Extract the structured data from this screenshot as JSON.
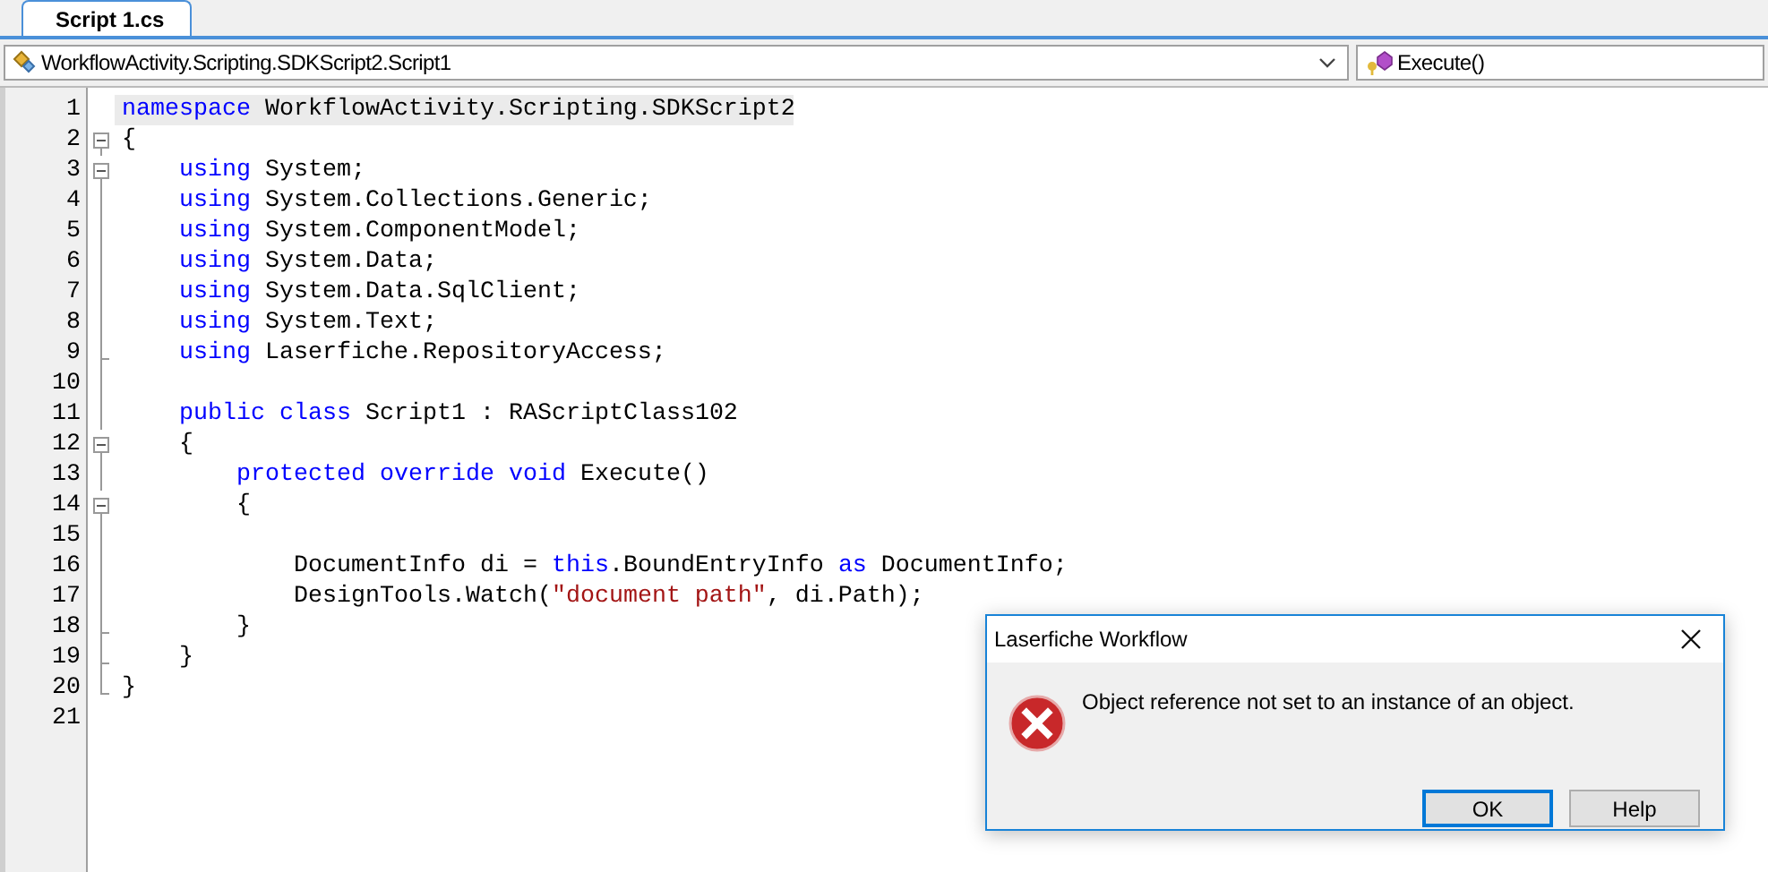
{
  "tabs": [
    {
      "label": "Script 1.cs",
      "selected": true
    }
  ],
  "nav": {
    "type_dropdown": "WorkflowActivity.Scripting.SDKScript2.Script1",
    "member_dropdown": "Execute()"
  },
  "lines": [
    {
      "number": "1",
      "kind": "plain",
      "current": true,
      "tokens": [
        {
          "kind": "keyword",
          "text": "namespace"
        },
        {
          "kind": "plain",
          "text": " WorkflowActivity.Scripting.SDKScript2"
        }
      ]
    },
    {
      "number": "2",
      "kind": "fold-start",
      "current": false,
      "tokens": [
        {
          "kind": "plain",
          "text": "{"
        }
      ]
    },
    {
      "number": "3",
      "kind": "fold-start",
      "current": false,
      "tokens": [
        {
          "kind": "keyword",
          "text": "    using"
        },
        {
          "kind": "plain",
          "text": " System;"
        }
      ]
    },
    {
      "number": "4",
      "kind": "fold-inner",
      "current": false,
      "tokens": [
        {
          "kind": "keyword",
          "text": "    using"
        },
        {
          "kind": "plain",
          "text": " System.Collections.Generic;"
        }
      ]
    },
    {
      "number": "5",
      "kind": "fold-inner",
      "current": false,
      "tokens": [
        {
          "kind": "keyword",
          "text": "    using"
        },
        {
          "kind": "plain",
          "text": " System.ComponentModel;"
        }
      ]
    },
    {
      "number": "6",
      "kind": "fold-inner",
      "current": false,
      "tokens": [
        {
          "kind": "keyword",
          "text": "    using"
        },
        {
          "kind": "plain",
          "text": " System.Data;"
        }
      ]
    },
    {
      "number": "7",
      "kind": "fold-inner",
      "current": false,
      "tokens": [
        {
          "kind": "keyword",
          "text": "    using"
        },
        {
          "kind": "plain",
          "text": " System.Data.SqlClient;"
        }
      ]
    },
    {
      "number": "8",
      "kind": "fold-inner",
      "current": false,
      "tokens": [
        {
          "kind": "keyword",
          "text": "    using"
        },
        {
          "kind": "plain",
          "text": " System.Text;"
        }
      ]
    },
    {
      "number": "9",
      "kind": "fold-end",
      "current": false,
      "tokens": [
        {
          "kind": "keyword",
          "text": "    using"
        },
        {
          "kind": "plain",
          "text": " Laserfiche.RepositoryAccess;"
        }
      ]
    },
    {
      "number": "10",
      "kind": "fold-inner",
      "current": false
    },
    {
      "number": "11",
      "kind": "fold-inner",
      "current": false,
      "tokens": [
        {
          "kind": "keyword",
          "text": "    public class"
        },
        {
          "kind": "plain",
          "text": " Script1 : RAScriptClass102"
        }
      ]
    },
    {
      "number": "12",
      "kind": "fold-start",
      "current": false,
      "tokens": [
        {
          "kind": "plain",
          "text": "    {"
        }
      ]
    },
    {
      "number": "13",
      "kind": "fold-inner",
      "current": false,
      "tokens": [
        {
          "kind": "keyword",
          "text": "        protected override void"
        },
        {
          "kind": "plain",
          "text": " Execute()"
        }
      ]
    },
    {
      "number": "14",
      "kind": "fold-start",
      "current": false,
      "tokens": [
        {
          "kind": "plain",
          "text": "        {"
        }
      ]
    },
    {
      "number": "15",
      "kind": "fold-inner",
      "current": false
    },
    {
      "number": "16",
      "kind": "fold-inner",
      "current": false,
      "tokens": [
        {
          "kind": "plain",
          "text": "            DocumentInfo di = "
        },
        {
          "kind": "keyword",
          "text": "this"
        },
        {
          "kind": "plain",
          "text": ".BoundEntryInfo "
        },
        {
          "kind": "keyword",
          "text": "as"
        },
        {
          "kind": "plain",
          "text": " DocumentInfo;"
        }
      ]
    },
    {
      "number": "17",
      "kind": "fold-inner",
      "current": false,
      "tokens": [
        {
          "kind": "plain",
          "text": "            DesignTools.Watch("
        },
        {
          "kind": "string",
          "text": "\"document path\""
        },
        {
          "kind": "plain",
          "text": ", di.Path);"
        }
      ]
    },
    {
      "number": "18",
      "kind": "fold-end",
      "current": false,
      "tokens": [
        {
          "kind": "plain",
          "text": "        }"
        }
      ]
    },
    {
      "number": "19",
      "kind": "fold-end",
      "current": false,
      "tokens": [
        {
          "kind": "plain",
          "text": "    }"
        }
      ]
    },
    {
      "number": "20",
      "kind": "fold-last",
      "current": false,
      "tokens": [
        {
          "kind": "plain",
          "text": "}"
        }
      ]
    },
    {
      "number": "21",
      "kind": "plain",
      "current": false
    }
  ],
  "dialog": {
    "title": "Laserfiche Workflow",
    "message": "Object reference not set to an instance of an object.",
    "buttons": [
      {
        "label": "OK",
        "default": true
      },
      {
        "label": "Help",
        "default": false
      }
    ]
  }
}
